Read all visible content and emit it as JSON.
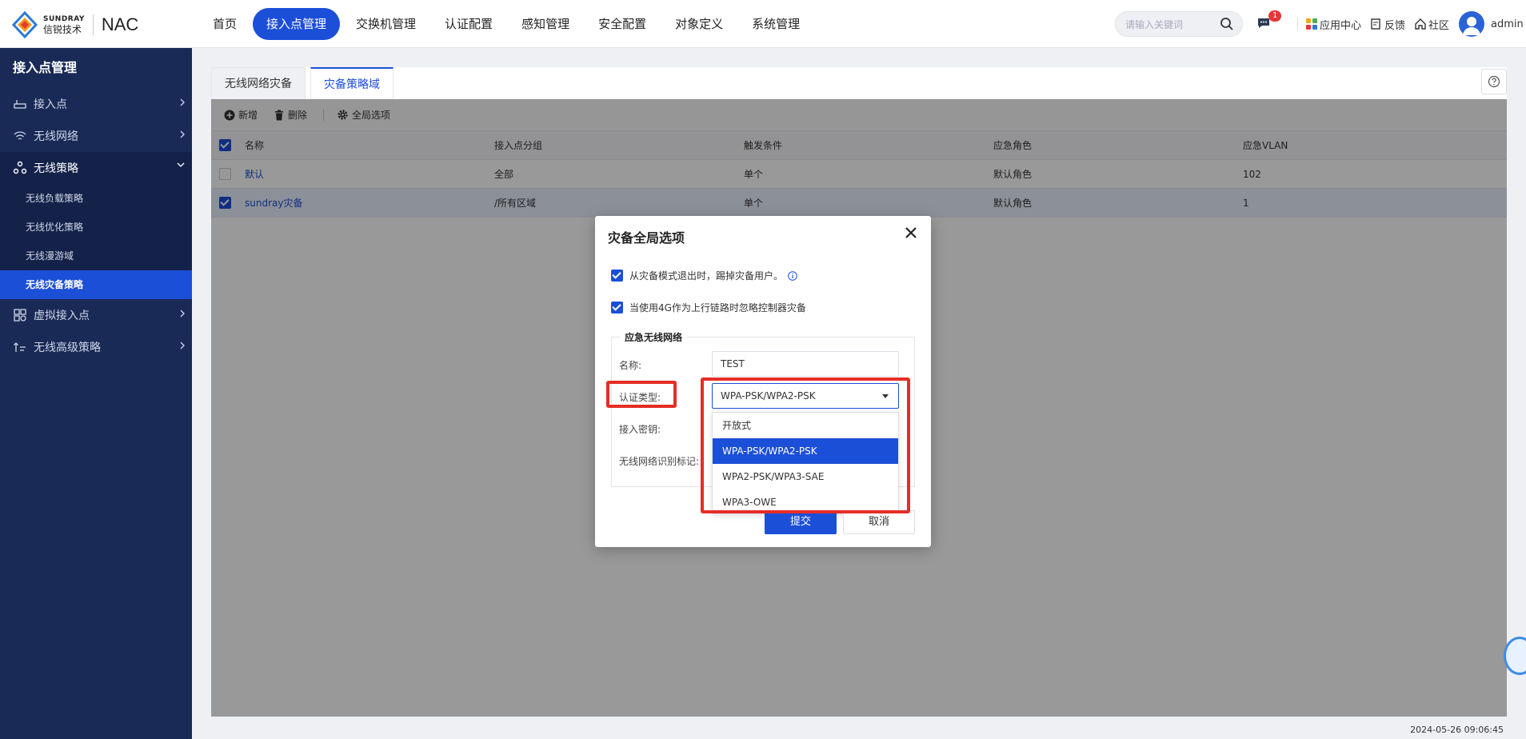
{
  "app": {
    "logo_en": "SUNDRAY",
    "logo_cn": "信锐技术",
    "product": "NAC"
  },
  "nav": {
    "items": [
      "首页",
      "接入点管理",
      "交换机管理",
      "认证配置",
      "感知管理",
      "安全配置",
      "对象定义",
      "系统管理"
    ],
    "active_index": 1
  },
  "search": {
    "placeholder": "请输入关键词"
  },
  "top_right": {
    "message_badge": "1",
    "app_center": "应用中心",
    "feedback": "反馈",
    "community": "社区",
    "user": "admin"
  },
  "sidebar": {
    "title": "接入点管理",
    "items": [
      {
        "label": "接入点",
        "icon": "router-icon"
      },
      {
        "label": "无线网络",
        "icon": "wifi-icon"
      },
      {
        "label": "无线策略",
        "icon": "policy-icon",
        "open": true,
        "children": [
          "无线负载策略",
          "无线优化策略",
          "无线漫游域",
          "无线灾备策略"
        ],
        "active_child": 3
      },
      {
        "label": "虚拟接入点",
        "icon": "virtual-ap-icon"
      },
      {
        "label": "无线高级策略",
        "icon": "advanced-icon"
      }
    ]
  },
  "tabs": [
    "无线网络灾备",
    "灾备策略域"
  ],
  "active_tab": 1,
  "toolbar": {
    "add": "新增",
    "delete": "删除",
    "global": "全局选项"
  },
  "table": {
    "columns": [
      "名称",
      "接入点分组",
      "触发条件",
      "应急角色",
      "应急VLAN"
    ],
    "rows": [
      {
        "checked": false,
        "cells": [
          "默认",
          "全部",
          "单个",
          "默认角色",
          "102"
        ]
      },
      {
        "checked": true,
        "cells": [
          "sundray灾备",
          "/所有区域",
          "单个",
          "默认角色",
          "1"
        ]
      }
    ]
  },
  "dialog": {
    "title": "灾备全局选项",
    "option1": "从灾备模式退出时，踢掉灾备用户。",
    "option2": "当使用4G作为上行链路时忽略控制器灾备",
    "section": "应急无线网络",
    "name_label": "名称:",
    "name_value": "TEST",
    "auth_label": "认证类型:",
    "auth_value": "WPA-PSK/WPA2-PSK",
    "key_label": "接入密钥:",
    "ssid_label": "无线网络识别标记:",
    "auth_options": [
      "开放式",
      "WPA-PSK/WPA2-PSK",
      "WPA2-PSK/WPA3-SAE",
      "WPA3-OWE"
    ],
    "auth_selected_index": 1,
    "submit": "提交",
    "cancel": "取消"
  },
  "timestamp": "2024-05-26 09:06:45",
  "colors": {
    "accent": "#1c4fd8",
    "sidebar": "#1a2a57",
    "highlight": "#e52d27"
  }
}
